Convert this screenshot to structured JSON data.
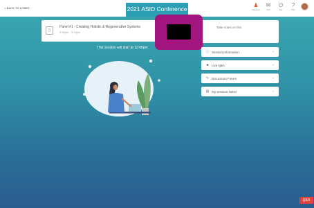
{
  "header": {
    "back_label": "< BACK TO LOBBY",
    "conference_title": "2021 ASID Conference",
    "nav": [
      {
        "name": "people-icon",
        "label": "Attendees",
        "glyph": "♟"
      },
      {
        "name": "chat-icon",
        "label": "Chat",
        "glyph": "✉"
      },
      {
        "name": "power-icon",
        "label": "Exit",
        "glyph": "⏻"
      },
      {
        "name": "help-icon",
        "label": "Help",
        "glyph": "?"
      }
    ]
  },
  "session": {
    "title": "Panel #1 - Creating Holistic & Regenerative Systems",
    "subtitle": "2:30pm - 3:15pm",
    "icon": "calendar-icon"
  },
  "notes": {
    "label": "Take notes on this"
  },
  "main": {
    "start_note": "This session will start at 12:00pm"
  },
  "sidebar": {
    "items": [
      {
        "label": "Session Information",
        "icon": "ⓘ"
      },
      {
        "label": "Live Q&A",
        "icon": "■"
      },
      {
        "label": "Discussion Forum",
        "icon": "✎"
      },
      {
        "label": "My Session Notes",
        "icon": "▤"
      }
    ]
  },
  "qa_badge": "Q&A"
}
